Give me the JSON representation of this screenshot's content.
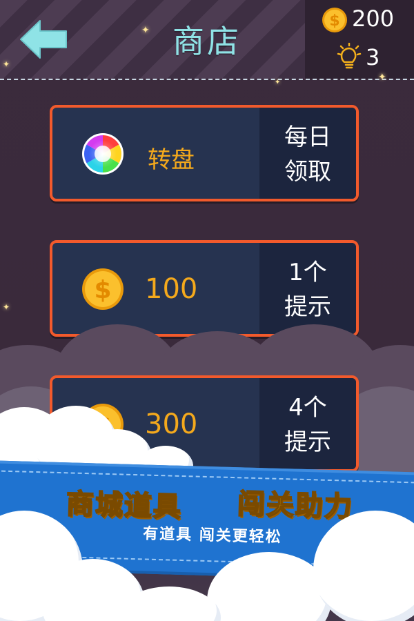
{
  "header": {
    "title": "商店",
    "coins": "200",
    "hints": "3"
  },
  "shop_items": [
    {
      "label": "转盘",
      "action": "每日\n领取",
      "action_line1": "每日",
      "action_line2": "领取",
      "icon": "color-wheel-icon"
    },
    {
      "label": "100",
      "action_line1": "1个",
      "action_line2": "提示",
      "icon": "coin-icon"
    },
    {
      "label": "300",
      "action_line1": "4个",
      "action_line2": "提示",
      "icon": "coin-icon"
    }
  ],
  "banner": {
    "headline_left": "商城道具",
    "headline_right": "闯关助力",
    "subline": "有道具 闯关更轻松"
  },
  "colors": {
    "title": "#8fe3e6",
    "item_border": "#f25a2c",
    "item_bg": "#263350",
    "gold_text": "#f4a91c",
    "banner_blue": "#1f73d0",
    "headline_yellow": "#ffd31a"
  }
}
